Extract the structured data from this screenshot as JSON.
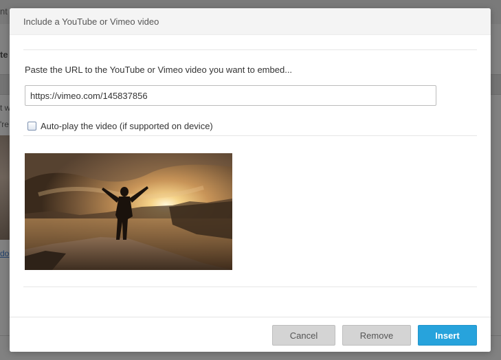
{
  "background": {
    "topbar_fragment": "nt",
    "heading_fragment": "te",
    "line1_fragment": "t w",
    "line2_fragment": "'re",
    "link_fragment": "do"
  },
  "dialog": {
    "title": "Include a YouTube or Vimeo video",
    "prompt": "Paste the URL to the YouTube or Vimeo video you want to embed...",
    "url_value": "https://vimeo.com/145837856",
    "autoplay_label": "Auto-play the video (if supported on device)",
    "autoplay_checked": false,
    "buttons": {
      "cancel": "Cancel",
      "remove": "Remove",
      "insert": "Insert"
    }
  },
  "colors": {
    "accent": "#27a3dc",
    "secondary_button": "#d4d4d4",
    "overlay": "#808080"
  }
}
